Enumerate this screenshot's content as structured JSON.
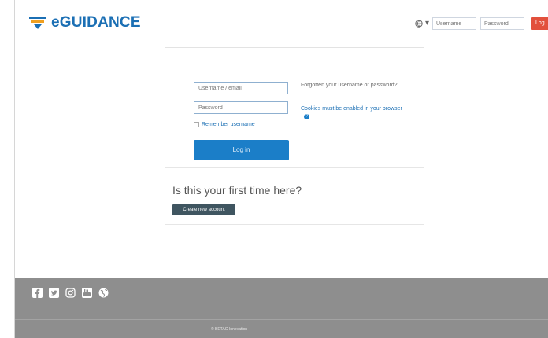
{
  "header": {
    "logo_text": "eGUIDANCE",
    "username_placeholder": "Username",
    "password_placeholder": "Password",
    "login_label": "Log"
  },
  "login": {
    "username_placeholder": "Username / email",
    "password_placeholder": "Password",
    "remember_label": "Remember username",
    "login_button": "Log in",
    "forgot_text": "Forgotten your username or password?",
    "cookies_text": "Cookies must be enabled in your browser"
  },
  "signup": {
    "title": "Is this your first time here?",
    "create_button": "Create new account"
  },
  "footer": {
    "social_icons": [
      "facebook-icon",
      "twitter-icon",
      "instagram-icon",
      "youtube-icon",
      "globe-icon"
    ],
    "copyright": "© BETAG Innovation"
  },
  "colors": {
    "brand": "#1b6fb4",
    "login_button": "#1b7ec8",
    "header_login": "#e2503c",
    "create_button": "#3f5560",
    "footer": "#8e8e8e"
  }
}
